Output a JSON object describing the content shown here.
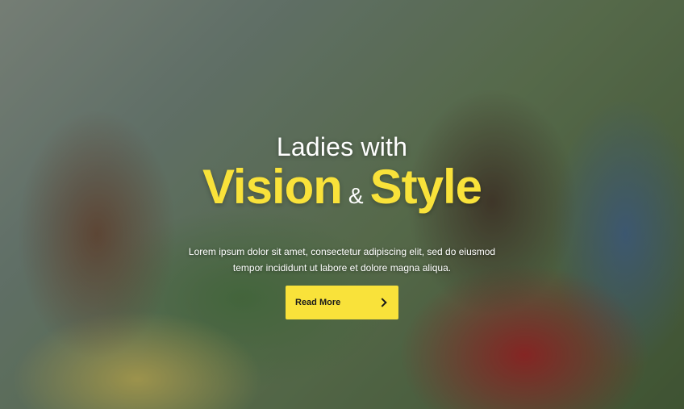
{
  "hero": {
    "subtitle": "Ladies with",
    "headline_word_1": "Vision",
    "headline_amp": "&",
    "headline_word_2": "Style",
    "description": "Lorem ipsum dolor sit amet, consectetur adipiscing elit, sed do eiusmod tempor incididunt ut labore et dolore magna aliqua.",
    "cta_label": "Read More",
    "accent_color": "#f9e23a",
    "cta_icon": "chevron-right-icon"
  }
}
